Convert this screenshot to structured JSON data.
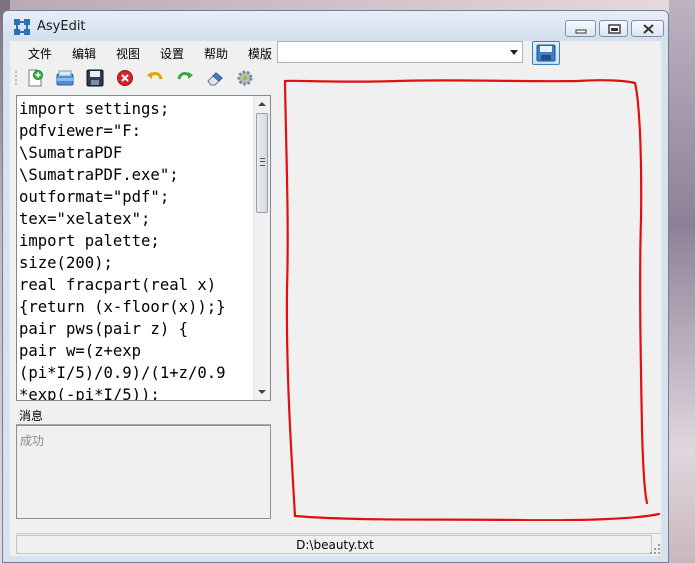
{
  "window": {
    "title": "AsyEdit"
  },
  "menu": {
    "items": [
      "文件",
      "编辑",
      "视图",
      "设置",
      "帮助",
      "模版"
    ]
  },
  "template_select": {
    "value": ""
  },
  "toolbar": {
    "buttons": [
      {
        "name": "new-file-icon"
      },
      {
        "name": "open-file-icon"
      },
      {
        "name": "save-icon"
      },
      {
        "name": "stop-icon"
      },
      {
        "name": "undo-icon"
      },
      {
        "name": "redo-icon"
      },
      {
        "name": "eraser-icon"
      },
      {
        "name": "settings-icon"
      }
    ]
  },
  "editor": {
    "lines": [
      "import settings;",
      "pdfviewer=\"F:",
      "\\SumatraPDF",
      "\\SumatraPDF.exe\";",
      "outformat=\"pdf\";",
      "tex=\"xelatex\";",
      "import palette;",
      "size(200);",
      "real fracpart(real x)",
      "{return (x-floor(x));}",
      "pair pws(pair z) {",
      "pair w=(z+exp",
      "(pi*I/5)/0.9)/(1+z/0.9",
      "*exp(-pi*I/5));"
    ]
  },
  "messages": {
    "title": "消息",
    "text": "成功"
  },
  "status": {
    "file_path": "D:\\beauty.txt"
  },
  "colors": {
    "annotation_red": "#e01010",
    "accent": "#3c7fb1"
  }
}
